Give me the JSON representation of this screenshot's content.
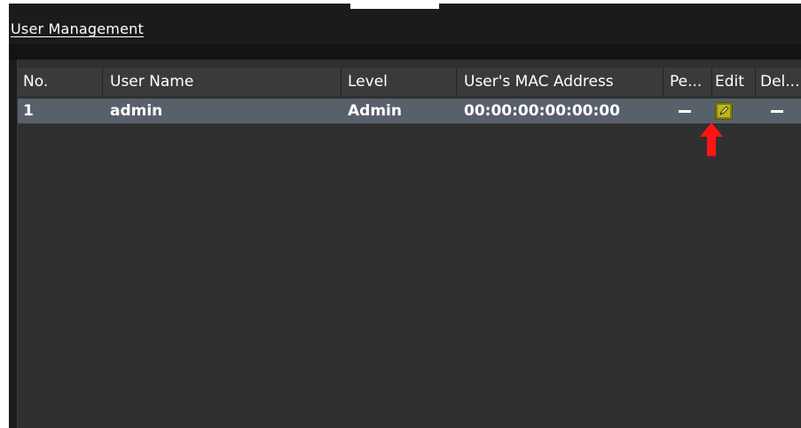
{
  "window": {
    "title": "User Management"
  },
  "table": {
    "columns": {
      "no": "No.",
      "user_name": "User Name",
      "level": "Level",
      "mac": "User's MAC Address",
      "permission": "Pe...",
      "edit": "Edit",
      "delete": "Del..."
    },
    "rows": [
      {
        "no": "1",
        "user_name": "admin",
        "level": "Admin",
        "mac": "00:00:00:00:00:00"
      }
    ]
  },
  "icons": {
    "permission": "dash-icon",
    "edit": "edit-icon",
    "delete": "dash-icon",
    "annotation": "red-arrow-up-icon"
  },
  "colors": {
    "window_bg": "#1b1b1b",
    "panel_bg": "#303030",
    "header_bg": "#3a3a3a",
    "row_selected": "#58616a",
    "edit_icon": "#b8b81e",
    "annotation_arrow": "#ff1414"
  }
}
